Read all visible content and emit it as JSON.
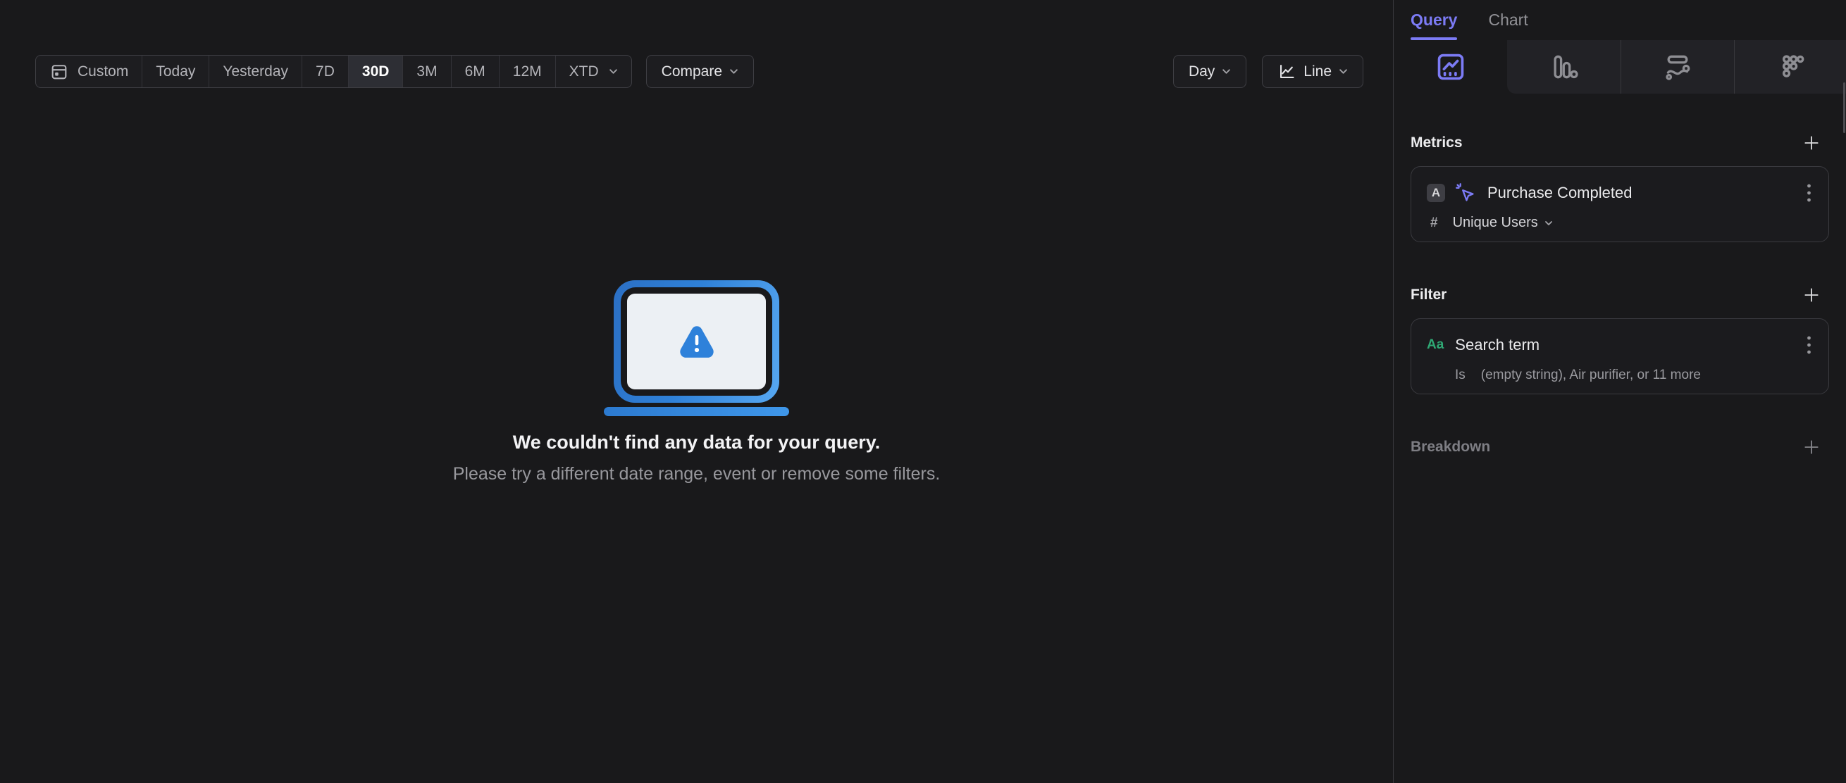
{
  "toolbar": {
    "date_ranges": [
      "Custom",
      "Today",
      "Yesterday",
      "7D",
      "30D",
      "3M",
      "6M",
      "12M",
      "XTD"
    ],
    "selected_range": "30D",
    "compare_label": "Compare",
    "granularity_label": "Day",
    "chart_type_label": "Line"
  },
  "empty_state": {
    "title": "We couldn't find any data for your query.",
    "subtitle": "Please try a different date range, event or remove some filters."
  },
  "panel": {
    "tabs": {
      "query": "Query",
      "chart": "Chart"
    },
    "view_tabs": [
      "insights",
      "funnels",
      "flows",
      "retention"
    ],
    "metrics": {
      "heading": "Metrics",
      "item": {
        "series_letter": "A",
        "event_name": "Purchase Completed",
        "aggregation_symbol": "#",
        "aggregation": "Unique Users"
      }
    },
    "filter": {
      "heading": "Filter",
      "item": {
        "type_icon_label": "Aa",
        "property": "Search term",
        "operator": "Is",
        "values_summary": "(empty string), Air purifier, or 11 more"
      }
    },
    "breakdown": {
      "heading": "Breakdown"
    }
  },
  "colors": {
    "accent_purple": "#7c7bf5",
    "accent_blue": "#2e81da",
    "accent_green": "#2fa874",
    "selected_segment_bg": "#2d2e34",
    "background": "#19191b"
  }
}
